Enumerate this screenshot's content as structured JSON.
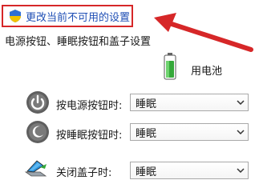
{
  "header": {
    "change_settings_link": "更改当前不可用的设置",
    "section_title": "电源按钮、睡眠按钮和盖子设置"
  },
  "columns": {
    "battery_label": "用电池"
  },
  "rows": [
    {
      "label": "按电源按钮时:",
      "value": "睡眠",
      "icon": "power-icon"
    },
    {
      "label": "按睡眠按钮时:",
      "value": "睡眠",
      "icon": "sleep-icon"
    },
    {
      "label": "关闭盖子时:",
      "value": "睡眠",
      "icon": "laptop-lid-icon"
    }
  ],
  "colors": {
    "link": "#1f4fb5",
    "annotation": "#d62728"
  }
}
